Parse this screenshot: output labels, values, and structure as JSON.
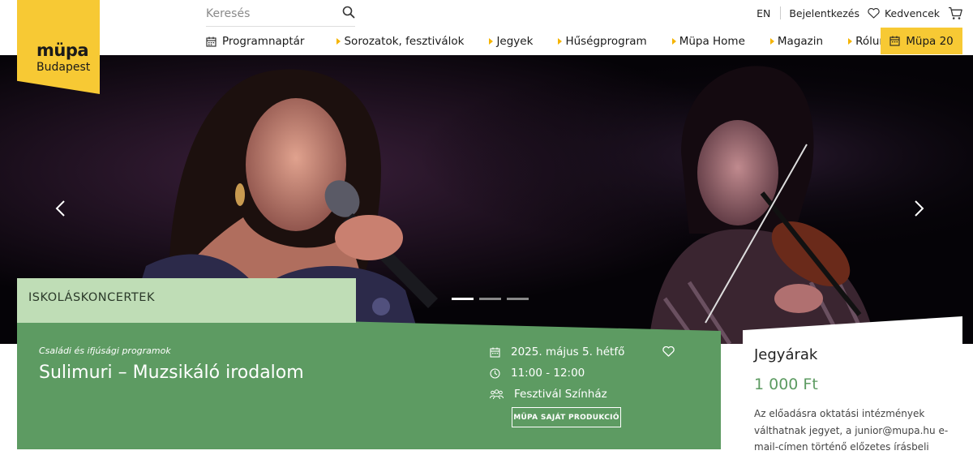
{
  "brand": {
    "logo_line1": "müpa",
    "logo_line2": "Budapest"
  },
  "search": {
    "placeholder": "Keresés",
    "icon": "search-icon"
  },
  "top_links": {
    "language": "EN",
    "login": "Bejelentkezés",
    "favorites": "Kedvencek",
    "cart_icon": "cart-icon"
  },
  "nav": {
    "items": [
      {
        "label": "Programnaptár",
        "icon": "calendar-icon"
      },
      {
        "label": "Sorozatok, fesztiválok"
      },
      {
        "label": "Jegyek"
      },
      {
        "label": "Hűségprogram"
      },
      {
        "label": "Müpa Home"
      },
      {
        "label": "Magazin"
      },
      {
        "label": "Rólunk"
      }
    ],
    "cta": {
      "label": "Müpa 20",
      "icon": "calendar-icon"
    }
  },
  "hero": {
    "slide_count": 3,
    "active_slide": 1
  },
  "event": {
    "tag": "ISKOLÁSKONCERTEK",
    "category": "Családi és ifjúsági programok",
    "title": "Sulimuri – Muzsikáló irodalom",
    "date": "2025. május 5. hétfő",
    "time": "11:00 - 12:00",
    "venue": "Fesztivál Színház",
    "badge": "MÜPA SAJÁT PRODUKCIÓ"
  },
  "pricing": {
    "heading": "Jegyárak",
    "price": "1 000 Ft",
    "note": "Az előadásra oktatási intézmények válthatnak jegyet, a junior@mupa.hu e-mail-címen történő előzetes írásbeli foglalás alapján."
  },
  "colors": {
    "brand_yellow": "#f7c934",
    "event_green": "#5d9b62",
    "tag_green": "#bfddb6",
    "nav_arrow": "#f5b400"
  }
}
